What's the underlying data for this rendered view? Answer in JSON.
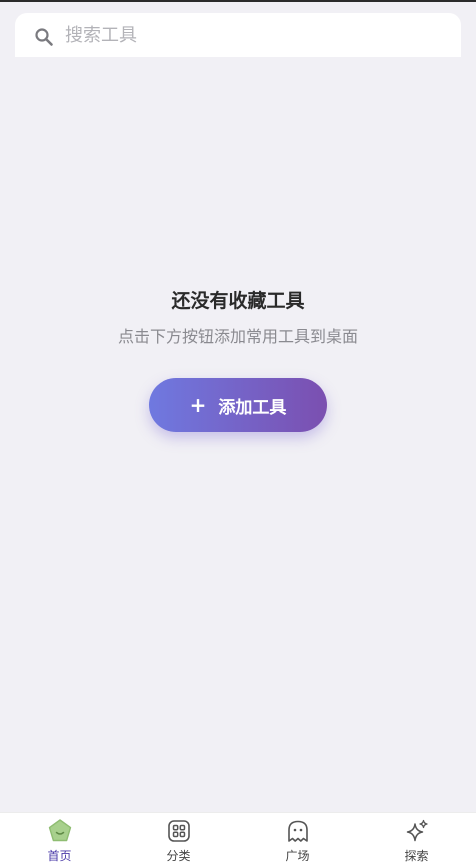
{
  "search": {
    "placeholder": "搜索工具",
    "value": "",
    "icon": "search-icon"
  },
  "empty_state": {
    "title": "还没有收藏工具",
    "subtitle": "点击下方按钮添加常用工具到桌面"
  },
  "add_button": {
    "icon": "plus-icon",
    "icon_glyph": "+",
    "label": "添加工具"
  },
  "tabbar": {
    "active": "home",
    "tabs": [
      {
        "id": "home",
        "label": "首页",
        "icon": "home-pentagon-icon"
      },
      {
        "id": "category",
        "label": "分类",
        "icon": "grid-icon"
      },
      {
        "id": "square",
        "label": "广场",
        "icon": "ghost-icon"
      },
      {
        "id": "explore",
        "label": "探索",
        "icon": "sparkle-icon"
      }
    ]
  },
  "colors": {
    "background": "#f1f0f5",
    "button_gradient_start": "#6f79e0",
    "button_gradient_end": "#7b4fb0",
    "active_tab": "#4a3aa8",
    "home_icon_fill": "#a8d08d"
  }
}
